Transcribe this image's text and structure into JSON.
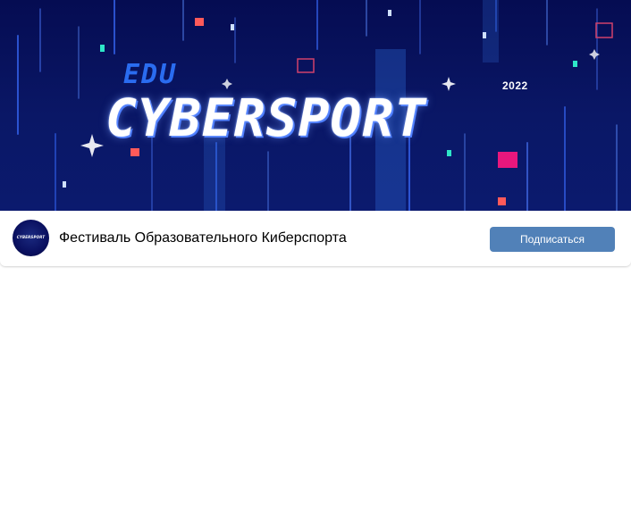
{
  "cover": {
    "brand_edu": "EDU",
    "brand_title": "CYBERSPORT",
    "brand_year": "2022",
    "colors": {
      "background": "#0a1766",
      "accent_blue": "#2a6cf0",
      "accent_pink": "#e8177d",
      "accent_red": "#ff5a5a",
      "accent_cyan": "#2ee6c8"
    }
  },
  "group": {
    "avatar_text": "CYBERSPORT",
    "name": "Фестиваль Образовательного Киберспорта",
    "subscribe_label": "Подписаться",
    "button_color": "#5181b8"
  }
}
